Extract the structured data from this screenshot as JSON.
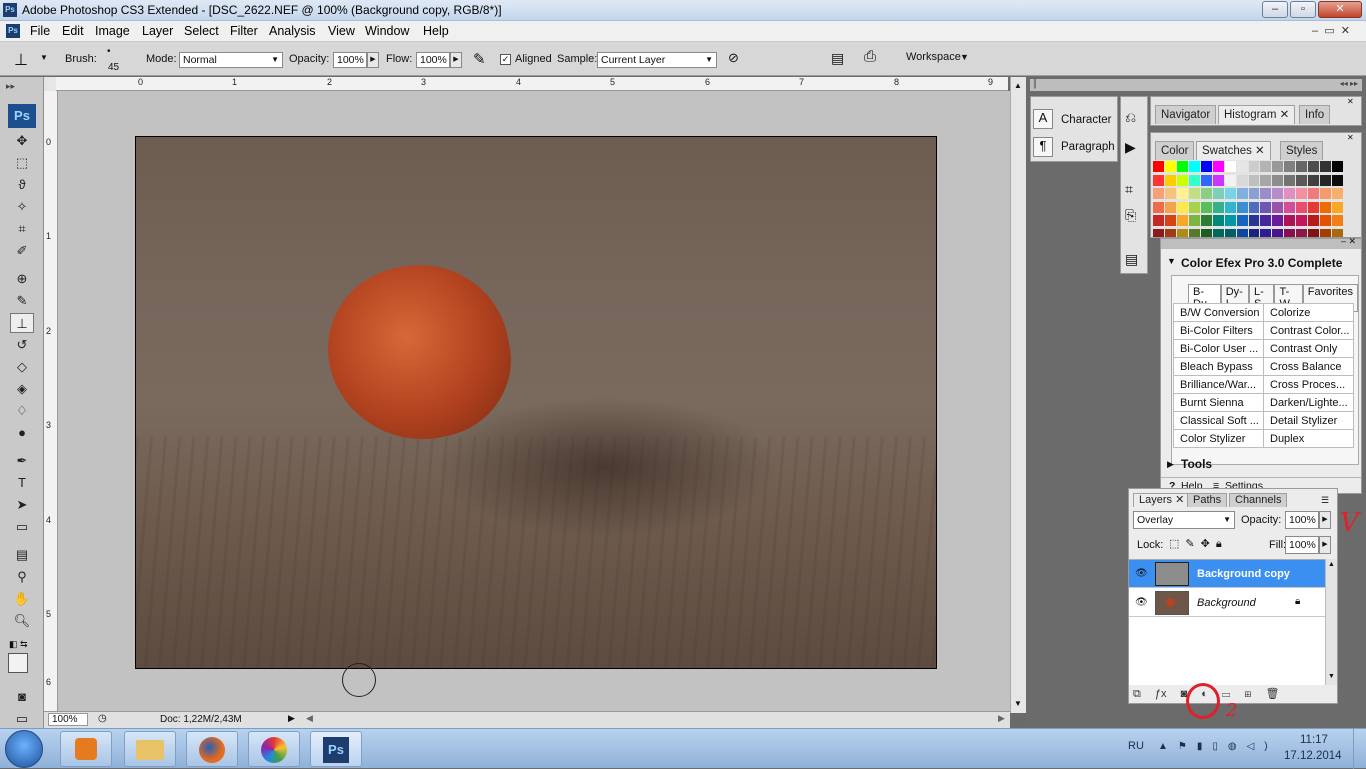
{
  "titlebar": {
    "app_icon": "Ps",
    "title": "Adobe Photoshop CS3 Extended - [DSC_2622.NEF @ 100% (Background copy, RGB/8*)]"
  },
  "menu": {
    "items": [
      "File",
      "Edit",
      "Image",
      "Layer",
      "Select",
      "Filter",
      "Analysis",
      "View",
      "Window",
      "Help"
    ]
  },
  "options": {
    "brush_label": "Brush:",
    "brush_size": "45",
    "mode_label": "Mode:",
    "mode_value": "Normal",
    "opacity_label": "Opacity:",
    "opacity_value": "100%",
    "flow_label": "Flow:",
    "flow_value": "100%",
    "aligned_label": "Aligned",
    "sample_label": "Sample:",
    "sample_value": "Current Layer",
    "workspace_label": "Workspace"
  },
  "toolbox": {
    "logo": "Ps"
  },
  "rulers": {
    "top": [
      "0",
      "1",
      "2",
      "3",
      "4",
      "5",
      "6",
      "7",
      "8",
      "9"
    ],
    "left": [
      "0",
      "1",
      "2",
      "3",
      "4",
      "5",
      "6"
    ]
  },
  "status": {
    "zoom": "100%",
    "doc": "Doc: 1,22M/2,43M"
  },
  "panels": {
    "char_para": {
      "character": "Character",
      "paragraph": "Paragraph"
    },
    "nav_group": {
      "tabs": [
        "Navigator",
        "Histogram",
        "Info"
      ]
    },
    "color_group": {
      "tabs": [
        "Color",
        "Swatches",
        "Styles"
      ]
    },
    "color_efex": {
      "title": "Color Efex Pro 3.0 Complete",
      "tabs": [
        "B-Du",
        "Dy-I",
        "L-S",
        "T-W",
        "Favorites"
      ],
      "filters_left": [
        "B/W Conversion",
        "Bi-Color Filters",
        "Bi-Color User ...",
        "Bleach Bypass",
        "Brilliance/War...",
        "Burnt Sienna",
        "Classical Soft ...",
        "Color Stylizer"
      ],
      "filters_right": [
        "Colorize",
        "Contrast Color...",
        "Contrast Only",
        "Cross Balance",
        "Cross Proces...",
        "Darken/Lighte...",
        "Detail Stylizer",
        "Duplex"
      ],
      "tools": "Tools",
      "help": "Help",
      "settings": "Settings"
    },
    "layers": {
      "tabs": [
        "Layers",
        "Paths",
        "Channels"
      ],
      "blend_mode": "Overlay",
      "opacity_label": "Opacity:",
      "opacity_value": "100%",
      "lock_label": "Lock:",
      "fill_label": "Fill:",
      "fill_value": "100%",
      "rows": [
        "Background copy",
        "Background"
      ]
    }
  },
  "annotations": {
    "checkmark": "V",
    "number": "2"
  },
  "taskbar": {
    "lang": "RU",
    "time": "11:17",
    "date": "17.12.2014",
    "active_app": "Ps"
  }
}
